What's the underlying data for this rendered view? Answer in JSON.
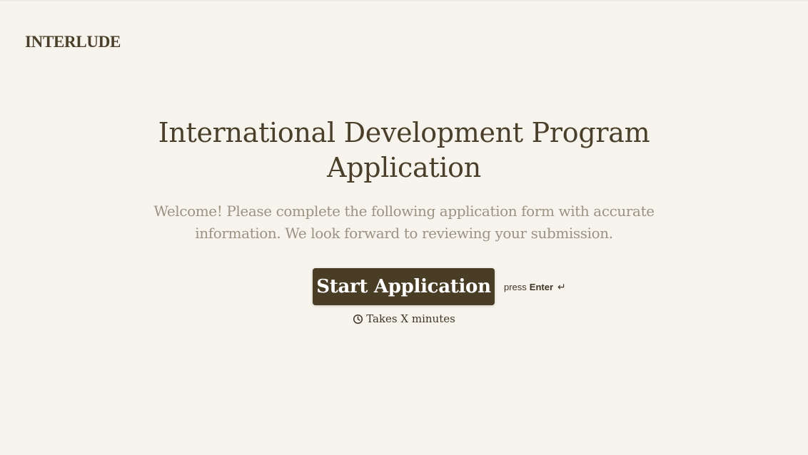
{
  "brand": {
    "logo_text": "INTERLUDE"
  },
  "hero": {
    "title": "International Development Program Application",
    "description": "Welcome! Please complete the following application form with accurate information. We look forward to reviewing your submission."
  },
  "cta": {
    "start_label": "Start Application",
    "hint_prefix": "press",
    "hint_key": "Enter",
    "hint_icon": "↵"
  },
  "duration": {
    "icon": "clock-icon",
    "text": "Takes X minutes"
  },
  "colors": {
    "background": "#f7f3ed",
    "primary": "#4a3d26",
    "heading": "#4a3f2a",
    "muted_text": "#9a9384"
  }
}
